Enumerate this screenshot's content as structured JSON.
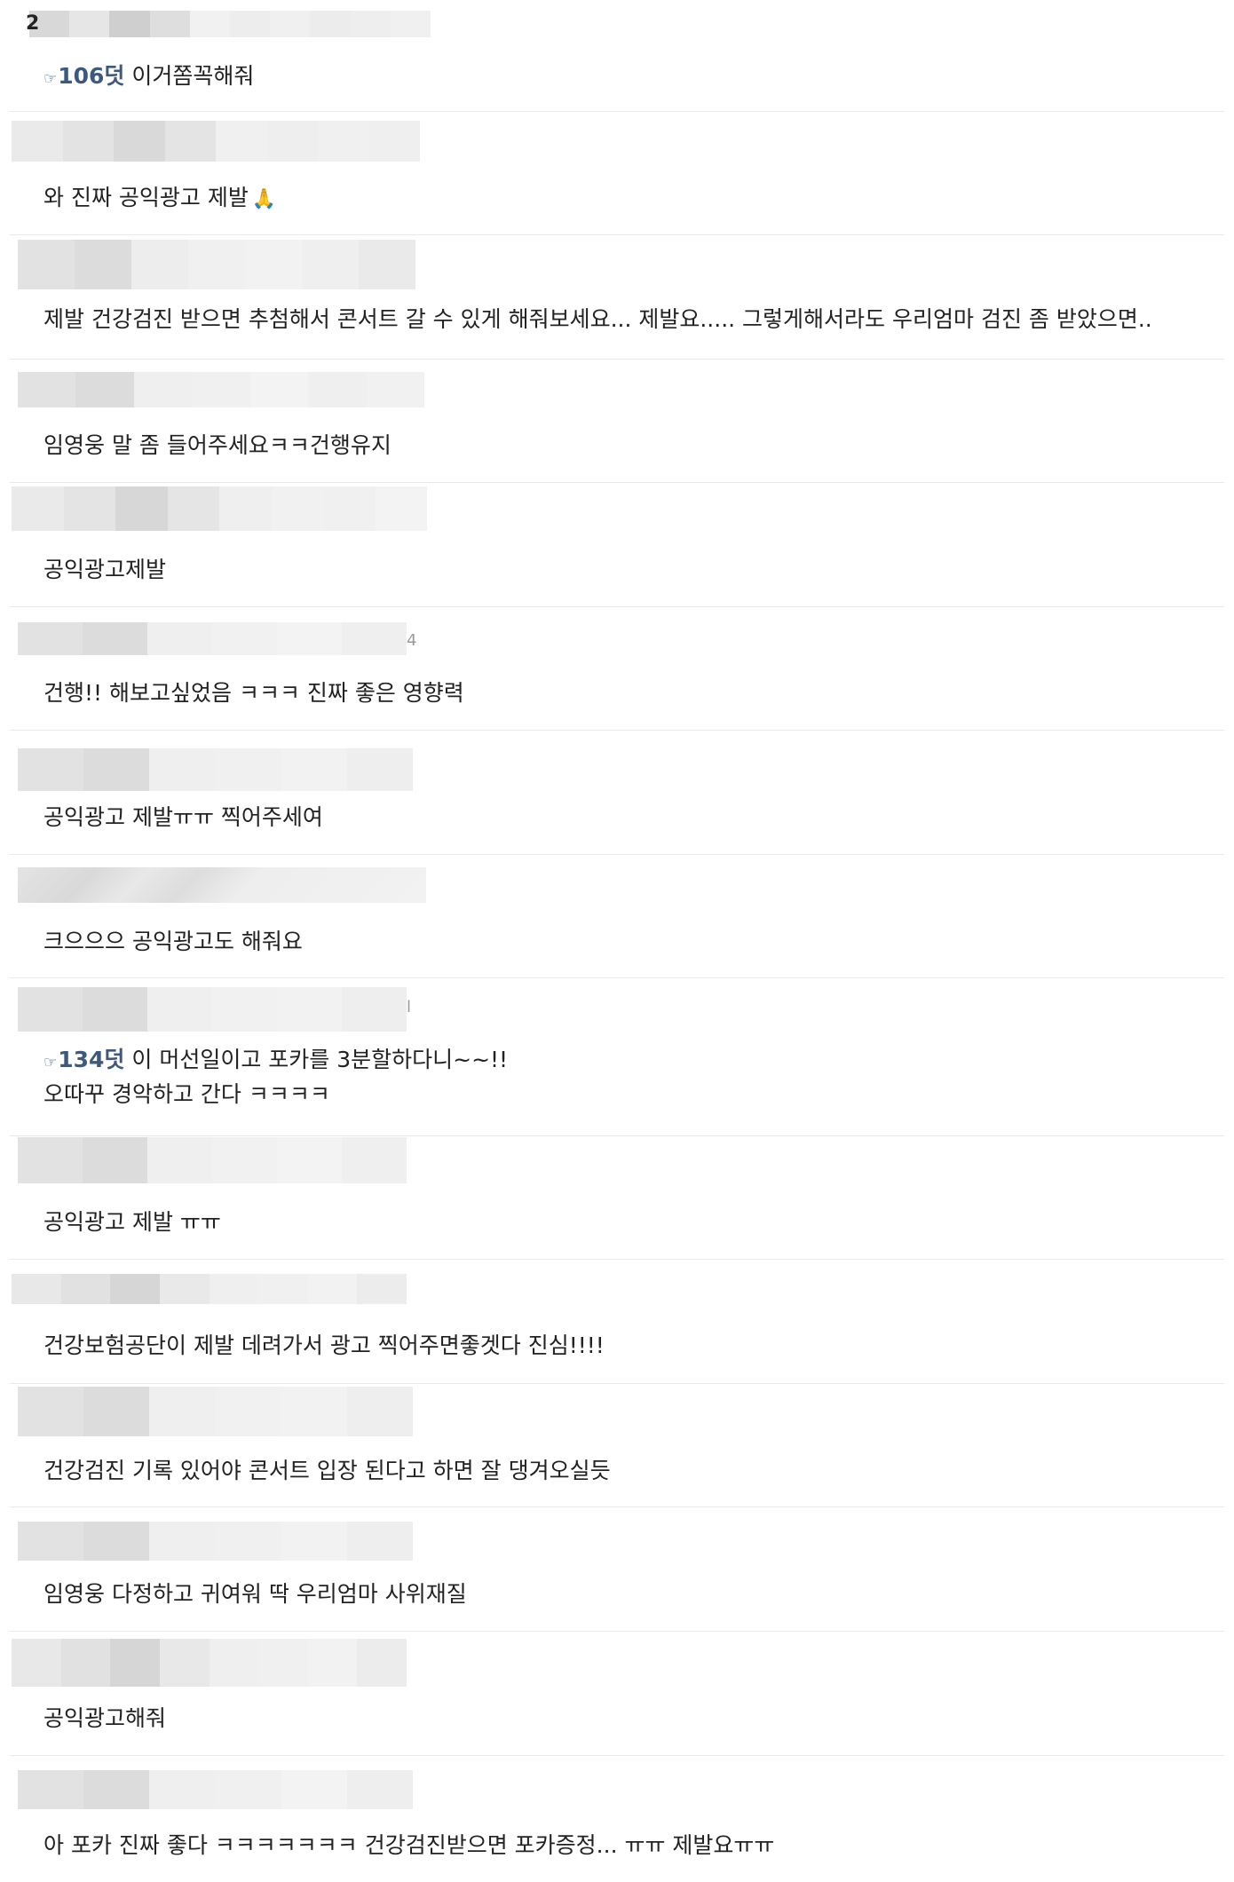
{
  "colors": {
    "mention": "#3d5a7e",
    "divider": "#e9e9e9",
    "text": "#222222"
  },
  "comments": [
    {
      "meta_prefix": "2",
      "mention_icon": "☞",
      "mention": "106덧",
      "text": "이거쫌꼭해줘"
    },
    {
      "text": "와 진짜 공익광고 제발",
      "emoji": "🙏"
    },
    {
      "text": "제발 건강검진 받으면 추첨해서 콘서트 갈 수 있게 해줘보세요... 제발요..... 그렇게해서라도 우리엄마 검진 좀 받았으면.."
    },
    {
      "text": "임영웅 말 좀 들어주세요ㅋㅋ건행유지"
    },
    {
      "text": "공익광고제발"
    },
    {
      "meta_extra": "4",
      "text": "건행!! 해보고싶었음 ㅋㅋㅋ 진짜 좋은 영향력"
    },
    {
      "text": "공익광고 제발ㅠㅠ 찍어주세여"
    },
    {
      "text": "크으으으 공익광고도 해줘요"
    },
    {
      "meta_extra": "l",
      "mention_icon": "☞",
      "mention": "134덧",
      "text": "이 머선일이고 포카를 3분할하다니~~!!",
      "text2": "오따꾸 경악하고 간다 ㅋㅋㅋㅋ"
    },
    {
      "text": "공익광고 제발 ㅠㅠ"
    },
    {
      "text": "건강보험공단이 제발 데려가서 광고 찍어주면좋겟다 진심!!!!"
    },
    {
      "text": "건강검진 기록 있어야 콘서트 입장 된다고 하면 잘 댕겨오실듯"
    },
    {
      "text": "임영웅 다정하고 귀여워 딱 우리엄마 사위재질"
    },
    {
      "text": "공익광고해줘"
    },
    {
      "text": "아 포카 진짜 좋다 ㅋㅋㅋㅋㅋㅋㅋ 건강검진받으면 포카증정... ㅠㅠ 제발요ㅠㅠ"
    }
  ]
}
